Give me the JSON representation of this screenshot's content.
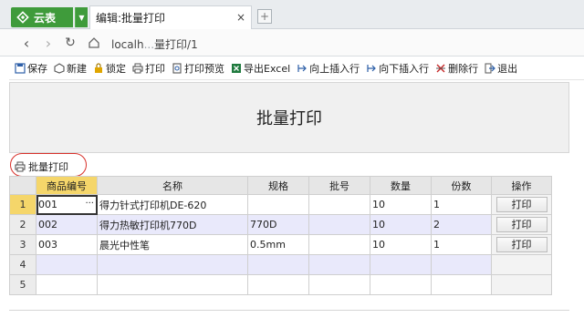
{
  "browser": {
    "app_name": "云表",
    "tab_title": "编辑:批量打印",
    "tab_close": "×",
    "new_tab": "+",
    "url_visible": "localh",
    "url_faded": "...",
    "url_tail": "量打印/1"
  },
  "toolbar": {
    "items": [
      {
        "label": "保存",
        "icon": "save-icon"
      },
      {
        "label": "新建",
        "icon": "new-icon"
      },
      {
        "label": "锁定",
        "icon": "lock-icon"
      },
      {
        "label": "打印",
        "icon": "print-icon"
      },
      {
        "label": "打印预览",
        "icon": "print-preview-icon"
      },
      {
        "label": "导出Excel",
        "icon": "excel-icon"
      },
      {
        "label": "向上插入行",
        "icon": "insert-above-icon"
      },
      {
        "label": "向下插入行",
        "icon": "insert-below-icon"
      },
      {
        "label": "删除行",
        "icon": "delete-row-icon"
      },
      {
        "label": "退出",
        "icon": "exit-icon"
      }
    ]
  },
  "form": {
    "title": "批量打印",
    "batch_print_label": "批量打印"
  },
  "grid": {
    "columns": [
      "商品编号",
      "名称",
      "规格",
      "批号",
      "数量",
      "份数",
      "操作"
    ],
    "rows": [
      {
        "n": "1",
        "code": "001",
        "name": "得力针式打印机DE-620",
        "spec": "",
        "batch": "",
        "qty": "10",
        "copies": "1",
        "action": "打印"
      },
      {
        "n": "2",
        "code": "002",
        "name": "得力热敏打印机770D",
        "spec": "770D",
        "batch": "",
        "qty": "10",
        "copies": "2",
        "action": "打印"
      },
      {
        "n": "3",
        "code": "003",
        "name": "晨光中性笔",
        "spec": "0.5mm",
        "batch": "",
        "qty": "10",
        "copies": "1",
        "action": "打印"
      },
      {
        "n": "4",
        "code": "",
        "name": "",
        "spec": "",
        "batch": "",
        "qty": "",
        "copies": "",
        "action": ""
      },
      {
        "n": "5",
        "code": "",
        "name": "",
        "spec": "",
        "batch": "",
        "qty": "",
        "copies": "",
        "action": ""
      }
    ],
    "selected_cell_ellipsis": "···"
  },
  "colors": {
    "app_green": "#3f9b3b",
    "active_header": "#f5d66a",
    "highlight_ring": "#d8312b",
    "even_row": "#e9e9fb"
  }
}
